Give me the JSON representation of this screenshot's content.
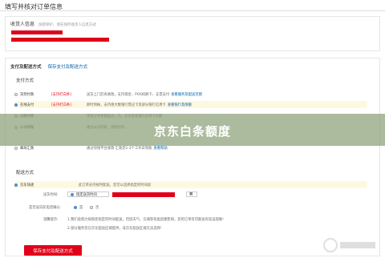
{
  "page_title": "填写并核对订单信息",
  "receiver": {
    "title": "收货人信息",
    "hint": "加密保护，请先保存收货人信息方式"
  },
  "payment": {
    "title": "支付及配送方式",
    "link": "保存支付及配送方式",
    "section": "支付方式",
    "methods": [
      {
        "name": "货到付款",
        "tag": "[支持打白条]",
        "desc": "送货上门后再收款，支持现金、POS机刷卡、支票支付",
        "link": "查看服务及配送范围"
      },
      {
        "name": "在线支付",
        "tag": "[支持打白条]",
        "desc": "即时到帐，支持绝大数银行借记卡及部分银行信用卡",
        "link": "查看银行及限额"
      },
      {
        "name": "分期付款",
        "tag": "",
        "desc": "单笔订单金额超过...元，支持多家银行信用卡分期",
        "link": ""
      },
      {
        "name": "公司转账",
        "tag": "",
        "desc": "通过公司转账，到账时间...",
        "link": ""
      },
      {
        "name": "邮局汇款",
        "tag": "",
        "desc": "通过快钱平台收款 汇款后1-3个工作日到账",
        "link": "查看帮助"
      }
    ]
  },
  "delivery": {
    "section": "配送方式",
    "method": "京东快递",
    "method_desc": "此订单支持按时配送，您可以选择指定的时间段",
    "time_label": "送货时间:",
    "time_opt": "指定送货时间",
    "confirm_label": "是否送货前电话确认:",
    "yes": "是",
    "no": "否",
    "note_label": "温馨提示:",
    "note1": "1.我们会努力按照您指定的时间配送，但因天气、交通等各类因素影响，您的订单有可能会有延误现象!",
    "note2": "2.部分服务仅在京东配送区域提供，非京东配送区域无法选择!"
  },
  "banner": "京东白条额度",
  "submit": "保存支付及配送方式"
}
